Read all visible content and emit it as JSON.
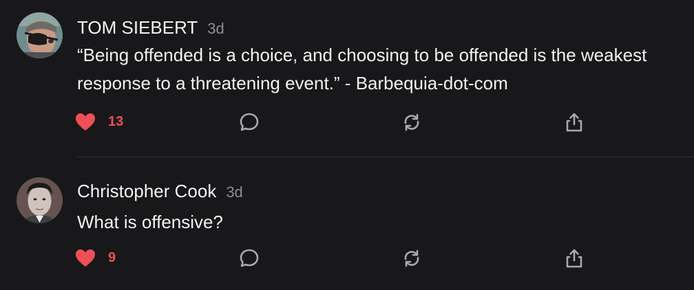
{
  "comments": [
    {
      "author": "TOM SIEBERT",
      "time": "3d",
      "text": "“Being offended is a choice, and choosing to be offended is the weakest response to a threatening event.” - Barbequia-dot-com",
      "likes": "13",
      "avatar_icon": "avatar-eyepatch-man"
    },
    {
      "author": "Christopher Cook",
      "time": "3d",
      "text": "What is offensive?",
      "likes": "9",
      "avatar_icon": "avatar-man-portrait"
    }
  ],
  "icons": {
    "like": "heart-icon",
    "reply": "speech-bubble-icon",
    "repost": "repost-icon",
    "share": "share-icon"
  },
  "colors": {
    "background": "#18181a",
    "like": "#ef4f55",
    "text": "#f2f2f2",
    "muted": "#8e8e93",
    "icon": "#a9a9ae"
  }
}
